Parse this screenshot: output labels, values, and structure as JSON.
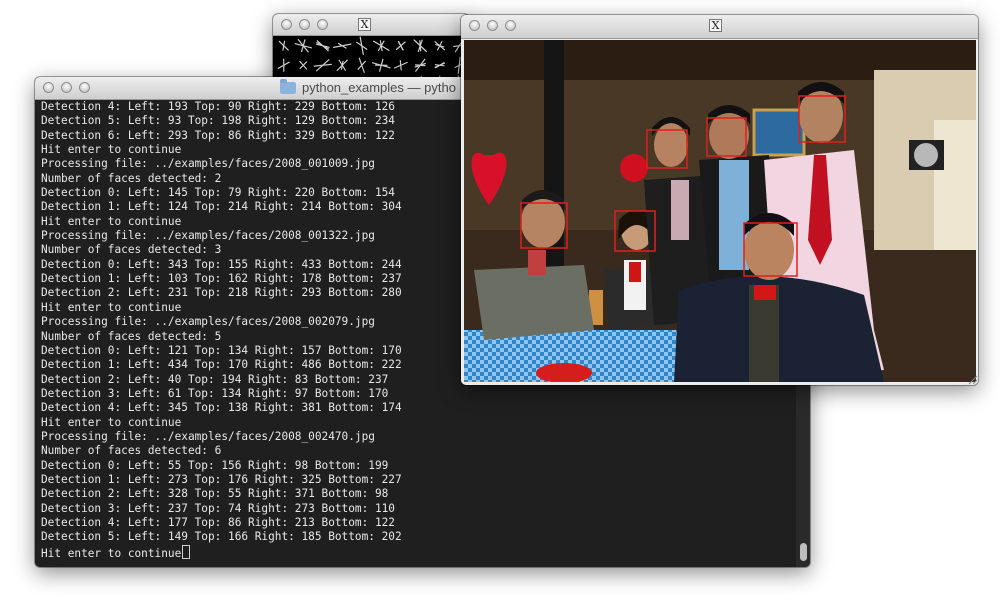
{
  "terminal": {
    "title": "python_examples — pytho",
    "lines": [
      "Detection 4: Left: 193 Top: 90 Right: 229 Bottom: 126",
      "Detection 5: Left: 93 Top: 198 Right: 129 Bottom: 234",
      "Detection 6: Left: 293 Top: 86 Right: 329 Bottom: 122",
      "Hit enter to continue",
      "Processing file: ../examples/faces/2008_001009.jpg",
      "Number of faces detected: 2",
      "Detection 0: Left: 145 Top: 79 Right: 220 Bottom: 154",
      "Detection 1: Left: 124 Top: 214 Right: 214 Bottom: 304",
      "Hit enter to continue",
      "Processing file: ../examples/faces/2008_001322.jpg",
      "Number of faces detected: 3",
      "Detection 0: Left: 343 Top: 155 Right: 433 Bottom: 244",
      "Detection 1: Left: 103 Top: 162 Right: 178 Bottom: 237",
      "Detection 2: Left: 231 Top: 218 Right: 293 Bottom: 280",
      "Hit enter to continue",
      "Processing file: ../examples/faces/2008_002079.jpg",
      "Number of faces detected: 5",
      "Detection 0: Left: 121 Top: 134 Right: 157 Bottom: 170",
      "Detection 1: Left: 434 Top: 170 Right: 486 Bottom: 222",
      "Detection 2: Left: 40 Top: 194 Right: 83 Bottom: 237",
      "Detection 3: Left: 61 Top: 134 Right: 97 Bottom: 170",
      "Detection 4: Left: 345 Top: 138 Right: 381 Bottom: 174",
      "Hit enter to continue",
      "Processing file: ../examples/faces/2008_002470.jpg",
      "Number of faces detected: 6",
      "Detection 0: Left: 55 Top: 156 Right: 98 Bottom: 199",
      "Detection 1: Left: 273 Top: 176 Right: 325 Bottom: 227",
      "Detection 2: Left: 328 Top: 55 Right: 371 Bottom: 98",
      "Detection 3: Left: 237 Top: 74 Right: 273 Bottom: 110",
      "Detection 4: Left: 177 Top: 86 Right: 213 Bottom: 122",
      "Detection 5: Left: 149 Top: 166 Right: 185 Bottom: 202",
      "Hit enter to continue"
    ]
  },
  "hog_window": {
    "x11_icon": "X"
  },
  "image_window": {
    "x11_icon": "X"
  },
  "colors": {
    "terminal_bg": "#1f1f1f",
    "terminal_text": "#e8e8e8",
    "detection_box": "#e0201c"
  }
}
